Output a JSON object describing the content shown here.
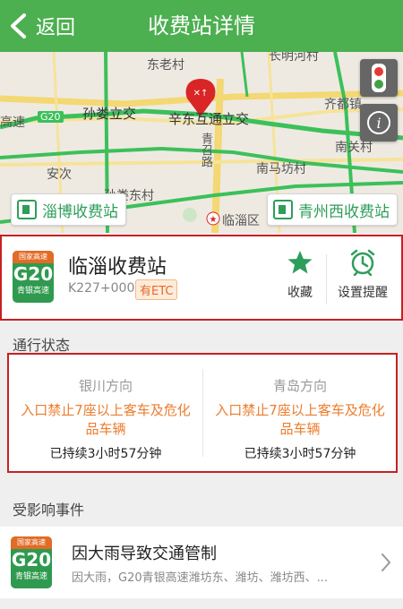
{
  "header": {
    "back_label": "返回",
    "title": "收费站详情"
  },
  "map": {
    "labels": {
      "dongcun": "东老村",
      "changgou": "长明河村",
      "sunlou": "孙娄立交",
      "xindong": "辛东互通立交",
      "qidu": "齐都镇",
      "gaosu": "高速",
      "anjia": "安次",
      "nanma": "南马坊村",
      "nanguan": "南关村",
      "sunloudong": "孙娄东村",
      "linzi": "临淄区",
      "qinglu": "青召路",
      "g20": "G20"
    },
    "left_station": "淄博收费站",
    "right_station": "青州西收费站",
    "colors": {
      "road_green": "#3cc05a",
      "road_yellow": "#f3d873",
      "pin_red": "#d92525"
    }
  },
  "station": {
    "badge_top": "国家高速",
    "badge_code": "G20",
    "badge_name": "青银高速",
    "name": "临淄收费站",
    "km": "K227+000",
    "etc": "有ETC",
    "favorite_label": "收藏",
    "reminder_label": "设置提醒"
  },
  "traffic": {
    "title": "通行状态",
    "directions": [
      {
        "name": "银川方向",
        "status": "入口禁止7座以上客车及危化品车辆",
        "duration": "已持续3小时57分钟"
      },
      {
        "name": "青岛方向",
        "status": "入口禁止7座以上客车及危化品车辆",
        "duration": "已持续3小时57分钟"
      }
    ]
  },
  "events": {
    "title": "受影响事件",
    "items": [
      {
        "badge_top": "国家高速",
        "badge_code": "G20",
        "badge_name": "青银高速",
        "title": "因大雨导致交通管制",
        "desc": "因大雨，G20青银高速潍坊东、潍坊、潍坊西、..."
      }
    ]
  },
  "colors": {
    "accent": "#4caf50",
    "warning": "#ec7c2c",
    "highlight_border": "#c82020"
  }
}
